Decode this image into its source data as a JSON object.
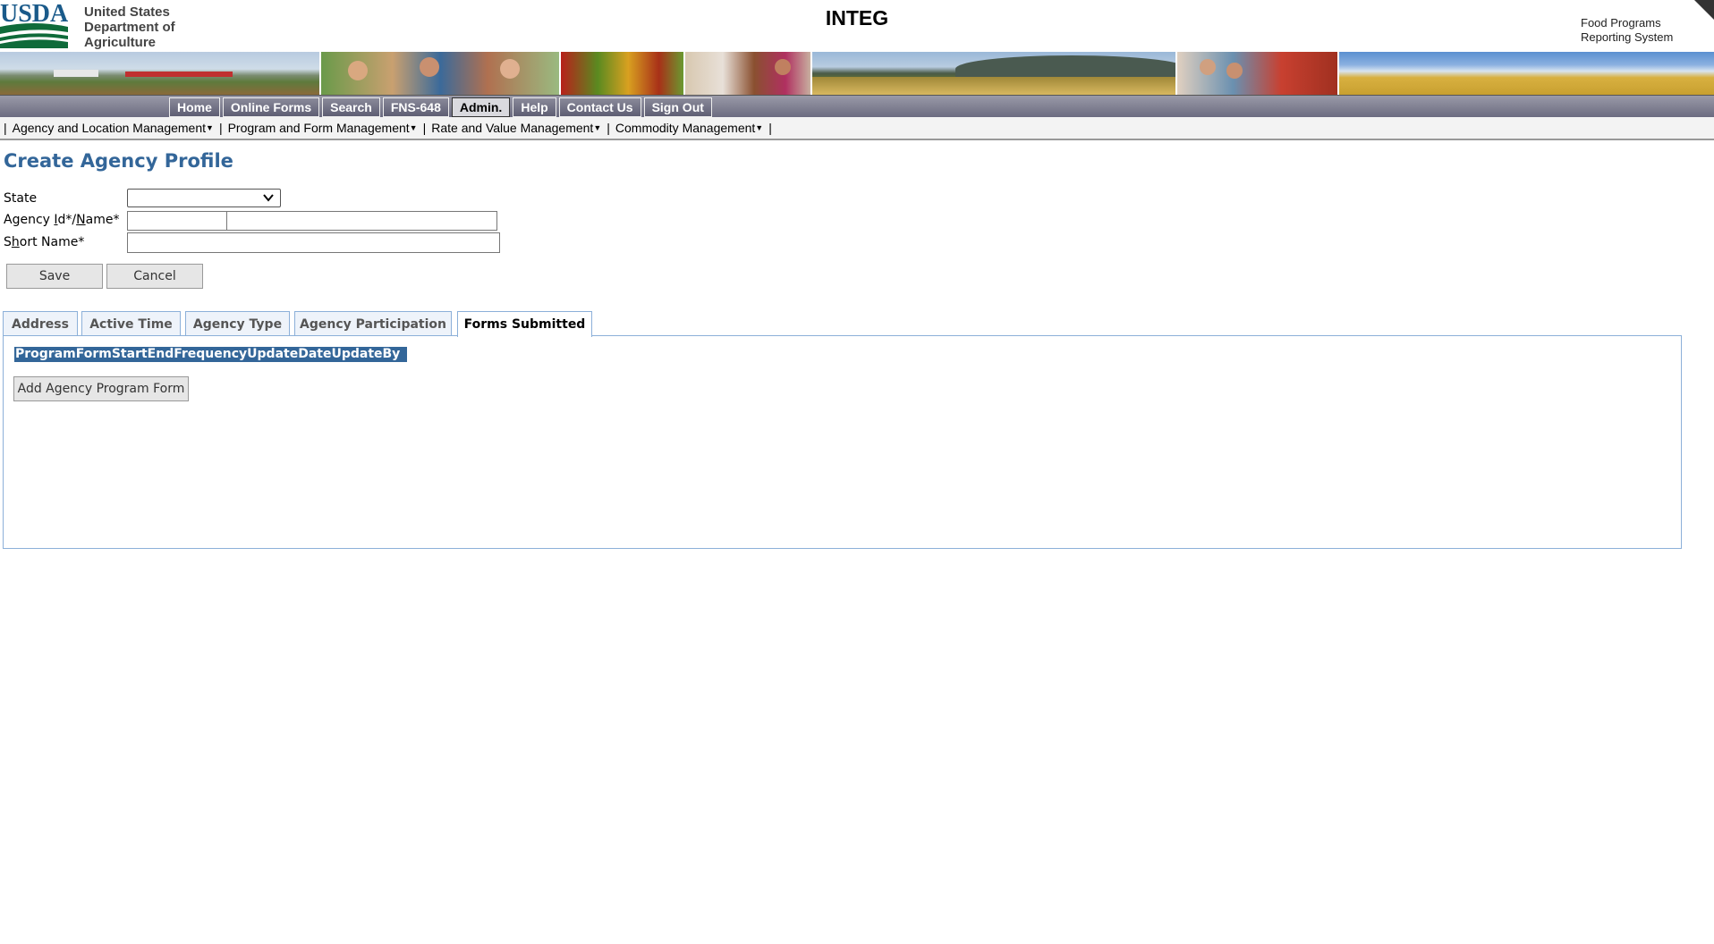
{
  "header": {
    "logo_text": "USDA",
    "agency_name": "United States\nDepartment of\nAgriculture",
    "environment": "INTEG",
    "system_name": "Food Programs\nReporting System"
  },
  "main_nav": {
    "items": [
      "Home",
      "Online Forms",
      "Search",
      "FNS-648",
      "Admin.",
      "Help",
      "Contact Us",
      "Sign Out"
    ],
    "active": "Admin."
  },
  "sub_nav": {
    "items": [
      "Agency and Location Management",
      "Program and Form Management",
      "Rate and Value Management",
      "Commodity Management"
    ]
  },
  "form": {
    "title": "Create Agency Profile",
    "state_label": "State",
    "state_value": "",
    "agency_label_pre": "Agency ",
    "agency_label_id_u": "I",
    "agency_label_id_rest": "d*/",
    "agency_label_name_u": "N",
    "agency_label_name_rest": "ame*",
    "agency_id_value": "",
    "agency_name_value": "",
    "short_label_pre": "S",
    "short_label_u": "h",
    "short_label_rest": "ort Name*",
    "short_name_value": "",
    "save_label": "Save",
    "cancel_label": "Cancel"
  },
  "tabs": {
    "items": [
      "Address",
      "Active Time",
      "Agency Type",
      "Agency Participation",
      "Forms Submitted"
    ],
    "active": "Forms Submitted"
  },
  "forms_submitted": {
    "table_header": "ProgramFormStartEndFrequencyUpdateDateUpdateBy",
    "add_button_label": "Add Agency Program Form"
  },
  "colors": {
    "title_blue": "#336699",
    "nav_bg": "#6b6b80",
    "tab_border": "#8cb0d9"
  }
}
